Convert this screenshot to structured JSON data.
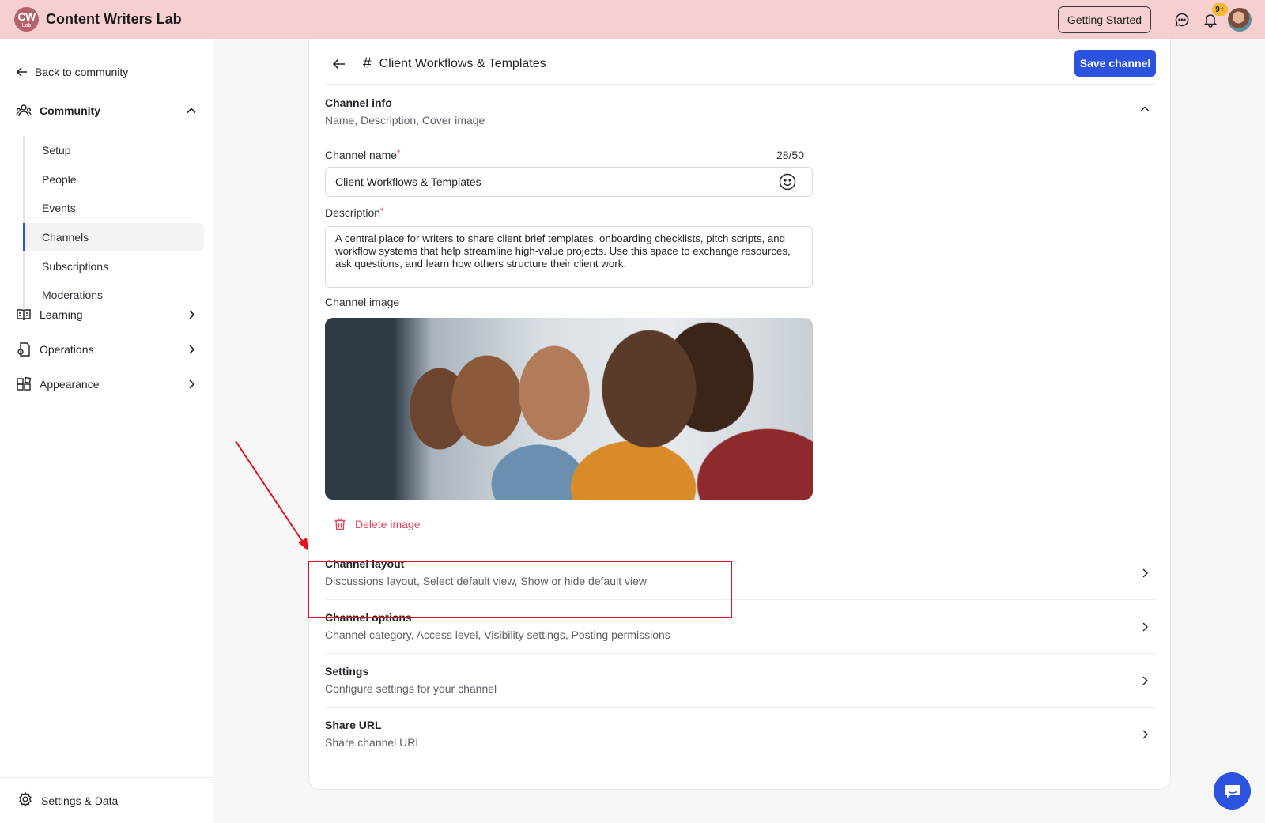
{
  "app": {
    "logo_text": "CW",
    "logo_subtext": "Lab",
    "title": "Content Writers Lab",
    "getting_started_label": "Getting Started",
    "notification_badge": "9+"
  },
  "sidebar": {
    "back_label": "Back to community",
    "community_label": "Community",
    "community_items": [
      {
        "label": "Setup"
      },
      {
        "label": "People"
      },
      {
        "label": "Events"
      },
      {
        "label": "Channels"
      },
      {
        "label": "Subscriptions"
      },
      {
        "label": "Moderations"
      }
    ],
    "active_item": "Channels",
    "groups": [
      {
        "label": "Learning",
        "icon": "book-icon"
      },
      {
        "label": "Operations",
        "icon": "operations-icon"
      },
      {
        "label": "Appearance",
        "icon": "appearance-icon"
      }
    ],
    "footer_label": "Settings & Data"
  },
  "header": {
    "hash": "#",
    "title": "Client Workflows & Templates",
    "save_label": "Save channel"
  },
  "channel_info": {
    "title": "Channel info",
    "subtitle": "Name, Description, Cover image",
    "name_label": "Channel name",
    "required_mark": "*",
    "name_counter": "28/50",
    "name_value": "Client Workflows & Templates",
    "description_label": "Description",
    "description_value": "A central place for writers to share client brief templates, onboarding checklists, pitch scripts, and workflow systems that help streamline high-value projects. Use this space to exchange resources, ask questions, and learn how others structure their client work.",
    "image_label": "Channel image",
    "delete_image_label": "Delete image"
  },
  "sections": [
    {
      "title": "Channel layout",
      "subtitle": "Discussions layout, Select default view, Show or hide default view"
    },
    {
      "title": "Channel options",
      "subtitle": "Channel category, Access level, Visibility settings, Posting permissions"
    },
    {
      "title": "Settings",
      "subtitle": "Configure settings for your channel"
    },
    {
      "title": "Share URL",
      "subtitle": "Share channel URL"
    }
  ],
  "colors": {
    "topbar": "#f6cfd1",
    "accent": "#2b53e0",
    "danger": "#e0465a",
    "annotation": "#e0121c"
  }
}
